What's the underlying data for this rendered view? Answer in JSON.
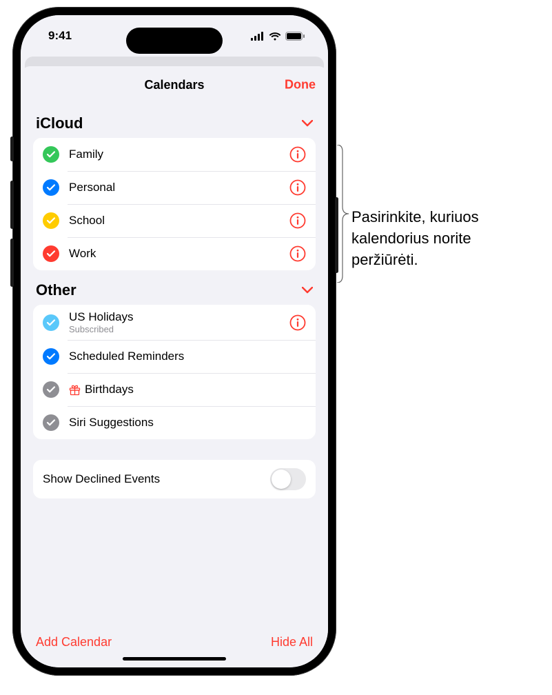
{
  "status": {
    "time": "9:41"
  },
  "sheet": {
    "title": "Calendars",
    "done": "Done"
  },
  "sections": {
    "icloud": {
      "title": "iCloud",
      "items": [
        {
          "label": "Family",
          "color": "#34c759"
        },
        {
          "label": "Personal",
          "color": "#007aff"
        },
        {
          "label": "School",
          "color": "#ffcc00"
        },
        {
          "label": "Work",
          "color": "#ff3b30"
        }
      ]
    },
    "other": {
      "title": "Other",
      "items": [
        {
          "label": "US Holidays",
          "sub": "Subscribed",
          "color": "#5ac8fa",
          "info": true
        },
        {
          "label": "Scheduled Reminders",
          "color": "#007aff"
        },
        {
          "label": "Birthdays",
          "color": "#8e8e93",
          "gift": true
        },
        {
          "label": "Siri Suggestions",
          "color": "#8e8e93"
        }
      ]
    }
  },
  "toggle": {
    "label": "Show Declined Events",
    "on": false
  },
  "footer": {
    "add": "Add Calendar",
    "hide": "Hide All"
  },
  "callout": "Pasirinkite, kuriuos kalendorius norite peržiūrėti."
}
